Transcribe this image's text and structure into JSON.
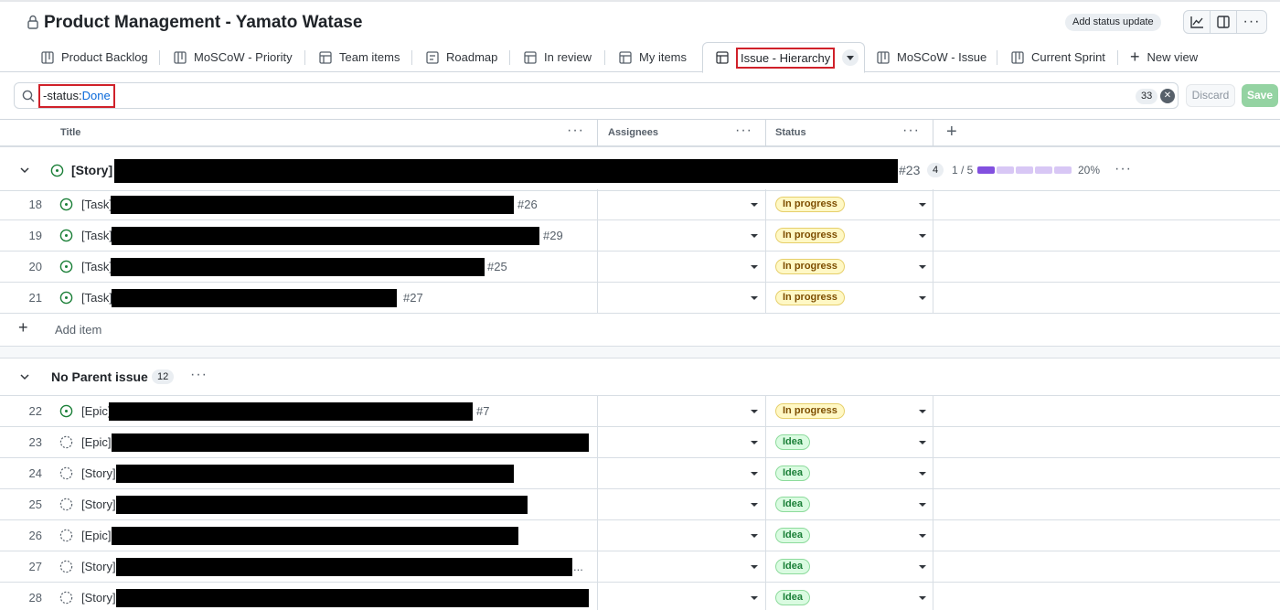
{
  "header": {
    "title": "Product Management - Yamato Watase",
    "status_update_label": "Add status update",
    "more_label": "···"
  },
  "tabs": [
    {
      "label": "Product Backlog",
      "icon": "board-icon"
    },
    {
      "label": "MoSCoW - Priority",
      "icon": "board-icon"
    },
    {
      "label": "Team items",
      "icon": "table-icon"
    },
    {
      "label": "Roadmap",
      "icon": "roadmap-icon"
    },
    {
      "label": "In review",
      "icon": "table-icon"
    },
    {
      "label": "My items",
      "icon": "table-icon"
    },
    {
      "label": "Issue - Hierarchy",
      "icon": "table-icon",
      "active": true
    },
    {
      "label": "MoSCoW - Issue",
      "icon": "board-icon"
    },
    {
      "label": "Current Sprint",
      "icon": "board-icon"
    }
  ],
  "new_view_label": "New view",
  "filter": {
    "query_prefix": "-status:",
    "query_value": "Done",
    "count": "33",
    "discard_label": "Discard",
    "save_label": "Save"
  },
  "columns": {
    "title": "Title",
    "assignees": "Assignees",
    "status": "Status",
    "menu": "···"
  },
  "group1": {
    "prefix": "[Story]",
    "ref": "#23",
    "count": "4",
    "progress_text": "1 / 5",
    "progress_percent": "20%",
    "progress_done": 1,
    "progress_total": 5,
    "menu": "···"
  },
  "group1_rows": [
    {
      "num": "18",
      "prefix": "[Task]",
      "ref": "#26",
      "status": "In progress"
    },
    {
      "num": "19",
      "prefix": "[Task]",
      "ref": "#29",
      "status": "In progress"
    },
    {
      "num": "20",
      "prefix": "[Task]",
      "ref": "#25",
      "status": "In progress"
    },
    {
      "num": "21",
      "prefix": "[Task]",
      "ref": "#27",
      "status": "In progress"
    }
  ],
  "add_item_label": "Add item",
  "group2": {
    "title": "No Parent issue",
    "count": "12",
    "menu": "···"
  },
  "group2_rows": [
    {
      "num": "22",
      "prefix": "[Epic]",
      "ref": "#7",
      "status": "In progress"
    },
    {
      "num": "23",
      "prefix": "[Epic]",
      "ref": "",
      "status": "Idea"
    },
    {
      "num": "24",
      "prefix": "[Story]",
      "ref": "",
      "status": "Idea"
    },
    {
      "num": "25",
      "prefix": "[Story]",
      "ref": "",
      "status": "Idea"
    },
    {
      "num": "26",
      "prefix": "[Epic]",
      "ref": "",
      "status": "Idea"
    },
    {
      "num": "27",
      "prefix": "[Story]",
      "ref": "...",
      "status": "Idea"
    },
    {
      "num": "28",
      "prefix": "[Story]",
      "ref": "",
      "status": "Idea"
    }
  ],
  "colors": {
    "open_issue": "#1a7f37",
    "progress_fill": "#8250df",
    "progress_empty": "#d8c7f5",
    "highlight_box": "#d0212a"
  }
}
